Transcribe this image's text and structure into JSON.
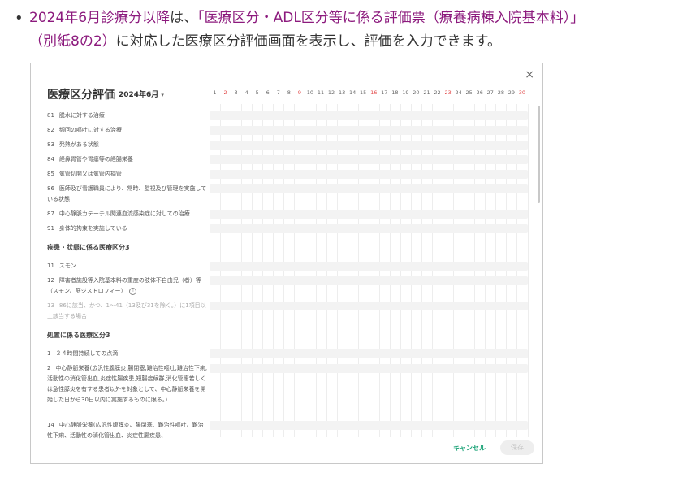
{
  "intro": {
    "link_text": "2024年6月診療分以降",
    "text_after_link": "は、",
    "quoted_title": "「医療区分・ADL区分等に係る評価票（療養病棟入院基本料）」",
    "line2_quoted": "（別紙8の2）",
    "line2_rest": "に対応した医療区分評価画面を表示し、評価を入力できます。"
  },
  "dialog": {
    "title": "医療区分評価",
    "month": "2024年6月",
    "days": [
      "1",
      "2",
      "3",
      "4",
      "5",
      "6",
      "7",
      "8",
      "9",
      "10",
      "11",
      "12",
      "13",
      "14",
      "15",
      "16",
      "17",
      "18",
      "19",
      "20",
      "21",
      "22",
      "23",
      "24",
      "25",
      "26",
      "27",
      "28",
      "29",
      "30"
    ],
    "red_days": [
      "2",
      "9",
      "16",
      "23",
      "30"
    ],
    "rows_a": [
      {
        "num": "81",
        "label": "脱水に対する治療"
      },
      {
        "num": "82",
        "label": "頻回の嘔吐に対する治療"
      },
      {
        "num": "83",
        "label": "発熱がある状態"
      },
      {
        "num": "84",
        "label": "経鼻胃管や胃瘻等の経腸栄養"
      },
      {
        "num": "85",
        "label": "気管切開又は気管内挿管"
      },
      {
        "num": "86",
        "label": "医師及び看護職員により、常時、監視及び管理を実施している状態"
      },
      {
        "num": "87",
        "label": "中心静脈カテーテル関連血流感染症に対しての治療"
      },
      {
        "num": "91",
        "label": "身体的拘束を実施している"
      }
    ],
    "section_b": "疾患・状態に係る医療区分3",
    "rows_b": [
      {
        "num": "11",
        "label": "スモン"
      },
      {
        "num": "12",
        "label": "障害者施設等入院基本料の重度の肢体不自由児（者）等（スモン、筋ジストロフィー）"
      },
      {
        "num": "13",
        "label": "86に該当、かつ、1〜41（13及び31を除く。）に1項目以上該当する場合"
      }
    ],
    "section_c": "処置に係る医療区分3",
    "rows_c": [
      {
        "num": "1",
        "label": "２４時間持続しての点滴"
      },
      {
        "num": "2",
        "label": "中心静脈栄養(広汎性腹膜炎,腸閉塞,難治性嘔吐,難治性下痢,活動性の消化管出血,炎症性腸疾患,短腸症候群,消化管瘻若しくは急性膵炎を有する患者以外を対象として、中心静脈栄養を開始した日から30日以内に実施するものに限る。)"
      },
      {
        "num": "14",
        "label": "中心静脈栄養(広汎性腹膜炎、腸閉塞、難治性嘔吐、難治性下痢、活動性の消化管出血、炎症性腸疾患、"
      }
    ],
    "cancel_label": "キャンセル",
    "save_label": "保存",
    "colors": {
      "accent": "#20a57a",
      "holiday": "#e24646",
      "link": "#8c1a7d"
    }
  }
}
